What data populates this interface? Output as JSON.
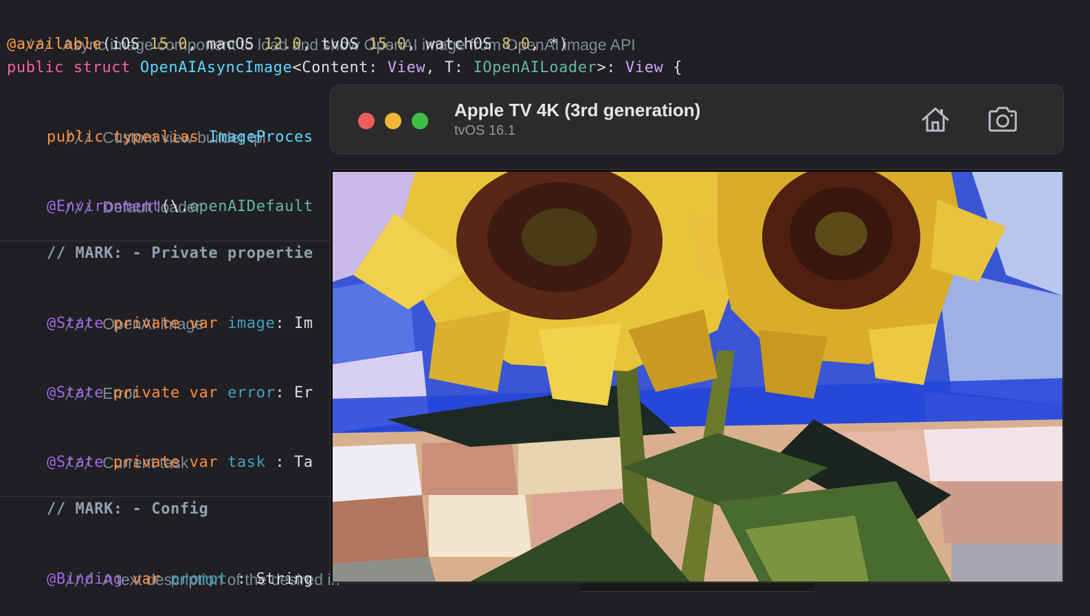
{
  "editor": {
    "lines": [
      {
        "id": "l1",
        "doc_slashes": "///",
        "doc_text": "Async image component to load and show OpenAI image from OpenAI image API"
      },
      {
        "id": "l2",
        "tokens": [
          "@available",
          "(",
          "iOS ",
          "15.0",
          ", ",
          "macOS ",
          "12.0",
          ", ",
          "tvOS ",
          "15.0",
          ", ",
          "watchOS ",
          "8.0",
          ", *)"
        ]
      },
      {
        "id": "l3",
        "tokens": [
          "public struct ",
          "OpenAIAsyncImage",
          "<Content: ",
          "View",
          ", T: ",
          "IOpenAILoader",
          ">: ",
          "View",
          " {"
        ]
      },
      {
        "id": "l4",
        "doc_slashes": "///",
        "doc_text": "Custom view builder tpl"
      },
      {
        "id": "l5",
        "tokens": [
          "public typealias ",
          "ImageProces"
        ]
      },
      {
        "id": "l6",
        "doc_slashes": "///",
        "doc_text": "Default loader"
      },
      {
        "id": "l7",
        "tokens": [
          "@Environment",
          "(\\.",
          "openAIDefault"
        ]
      },
      {
        "id": "l8",
        "mark_text": "// MARK: - Private propertie"
      },
      {
        "id": "l9",
        "doc_slashes": "///",
        "doc_text": "OpenAI image"
      },
      {
        "id": "l10",
        "tokens": [
          "@State ",
          "private var ",
          "image",
          ": Im"
        ]
      },
      {
        "id": "l11",
        "doc_slashes": "///",
        "doc_text": "Error"
      },
      {
        "id": "l12",
        "tokens": [
          "@State ",
          "private var ",
          "error",
          ": Er"
        ]
      },
      {
        "id": "l13",
        "doc_slashes": "///",
        "doc_text": "Current task"
      },
      {
        "id": "l14",
        "tokens": [
          "@State ",
          "private var ",
          "task",
          " : Ta"
        ]
      },
      {
        "id": "l15",
        "mark_text": "// MARK: - Config"
      },
      {
        "id": "l16",
        "doc_slashes": "///",
        "doc_text": "A text description of the desired in"
      },
      {
        "id": "l17",
        "tokens": [
          "@Binding ",
          "var ",
          "prompt",
          " : String"
        ]
      }
    ]
  },
  "simulator": {
    "device_name": "Apple TV 4K (3rd generation)",
    "os_version": "tvOS 16.1",
    "icons": {
      "close": "close-window-icon",
      "minimize": "minimize-window-icon",
      "zoom": "zoom-window-icon",
      "home": "home-icon",
      "screenshot": "camera-icon"
    },
    "screen_content": "sunflower-painting-image"
  },
  "colors": {
    "editor_bg": "#1f1f24",
    "keyword": "#fc5fa3",
    "attribute": "#ff9d3d",
    "number": "#d0bf69",
    "type": "#5dd8ff",
    "comment": "#7f8c98",
    "traffic_red": "#ec5f58",
    "traffic_yellow": "#f0b836",
    "traffic_green": "#3fbe46"
  }
}
